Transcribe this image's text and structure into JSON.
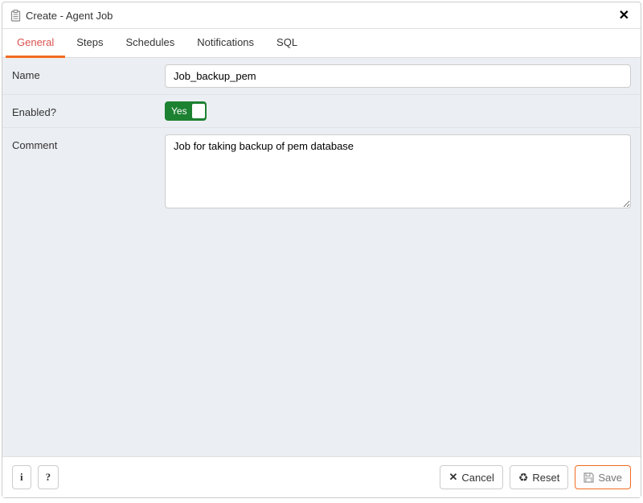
{
  "header": {
    "title": "Create - Agent Job"
  },
  "tabs": {
    "general": "General",
    "steps": "Steps",
    "schedules": "Schedules",
    "notifications": "Notifications",
    "sql": "SQL"
  },
  "form": {
    "name_label": "Name",
    "name_value": "Job_backup_pem",
    "enabled_label": "Enabled?",
    "enabled_value": "Yes",
    "comment_label": "Comment",
    "comment_value": "Job for taking backup of pem database"
  },
  "footer": {
    "info": "i",
    "help": "?",
    "cancel": "Cancel",
    "reset": "Reset",
    "save": "Save"
  }
}
